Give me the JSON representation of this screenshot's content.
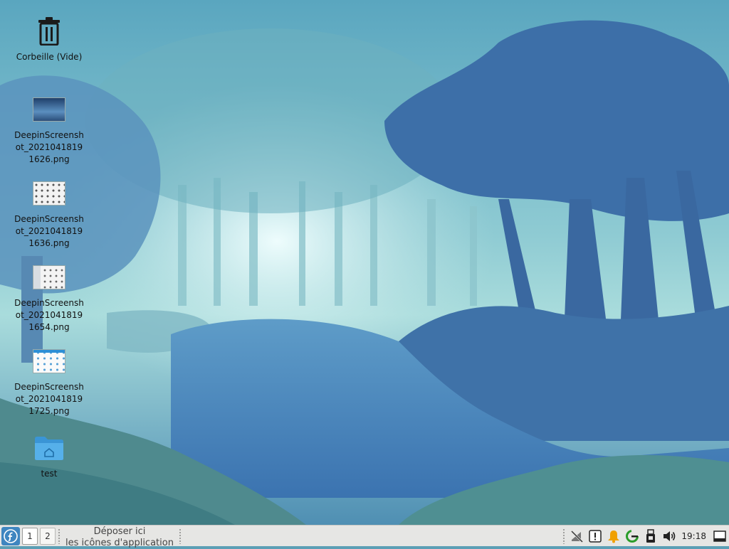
{
  "desktop": {
    "icons": [
      {
        "label": "Corbeille (Vide)",
        "icon": "trash-icon"
      },
      {
        "label": "DeepinScreenshot_20210418191626.png",
        "icon": "image-thumbnail-icon"
      },
      {
        "label": "DeepinScreenshot_20210418191636.png",
        "icon": "image-thumbnail-icon"
      },
      {
        "label": "DeepinScreenshot_20210418191654.png",
        "icon": "image-thumbnail-icon"
      },
      {
        "label": "DeepinScreenshot_20210418191725.png",
        "icon": "image-thumbnail-icon"
      },
      {
        "label": "test",
        "icon": "home-folder-icon"
      }
    ]
  },
  "taskbar": {
    "workspaces": [
      "1",
      "2"
    ],
    "launcher_hint_line1": "Déposer ici",
    "launcher_hint_line2": "les icônes d'application",
    "clock": "19:18",
    "tray_icons": [
      "network-disconnected-icon",
      "notification-icon",
      "bell-icon",
      "update-icon",
      "usb-icon",
      "volume-icon",
      "show-desktop-icon"
    ],
    "colors": {
      "panel": "#e6e6e4",
      "menu_button": "#3f86c0",
      "bell": "#f0a000",
      "update_ring": "#2a9d2a"
    }
  }
}
